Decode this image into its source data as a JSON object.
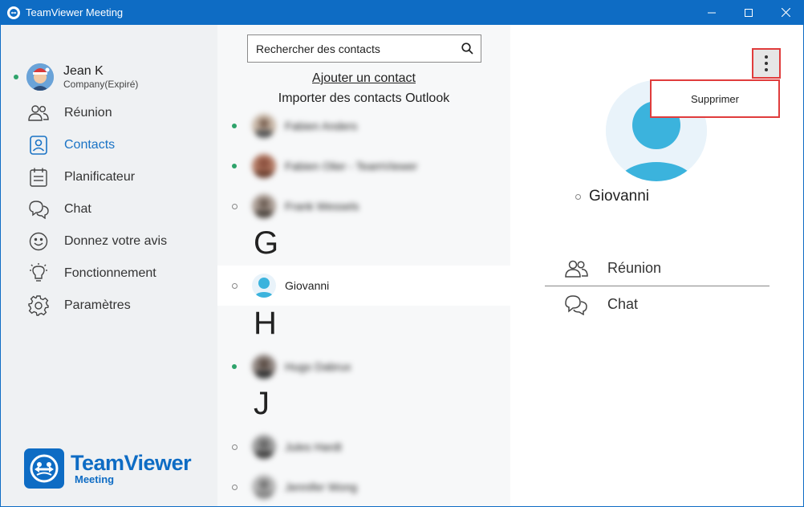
{
  "window": {
    "title": "TeamViewer Meeting"
  },
  "user": {
    "name": "Jean K",
    "company": "Company(Expiré)"
  },
  "nav": {
    "items": [
      {
        "label": "Réunion",
        "icon": "people-icon"
      },
      {
        "label": "Contacts",
        "icon": "contact-card-icon",
        "active": true
      },
      {
        "label": "Planificateur",
        "icon": "calendar-icon"
      },
      {
        "label": "Chat",
        "icon": "chat-bubbles-icon"
      },
      {
        "label": "Donnez votre avis",
        "icon": "smiley-icon"
      },
      {
        "label": "Fonctionnement",
        "icon": "lightbulb-icon"
      },
      {
        "label": "Paramètres",
        "icon": "gear-icon"
      }
    ]
  },
  "brand": {
    "name": "TeamViewer",
    "sub": "Meeting"
  },
  "contacts": {
    "search_placeholder": "Rechercher des contacts",
    "add_contact": "Ajouter un contact",
    "import_outlook": "Importer des contacts Outlook",
    "list": [
      {
        "name": "Fabien Anders",
        "status": "online",
        "blurred": true
      },
      {
        "name": "Fabien Olier - TeamViewer",
        "status": "online",
        "blurred": true
      },
      {
        "name": "Frank Wessels",
        "status": "offline",
        "blurred": true
      },
      {
        "letter": "G"
      },
      {
        "name": "Giovanni",
        "status": "offline",
        "selected": true
      },
      {
        "letter": "H"
      },
      {
        "name": "Hugo Dabrux",
        "status": "online",
        "blurred": true
      },
      {
        "letter": "J"
      },
      {
        "name": "Jules Hardt",
        "status": "offline",
        "blurred": true
      },
      {
        "name": "Jennifer Wong",
        "status": "offline",
        "blurred": true
      }
    ]
  },
  "detail": {
    "name": "Giovanni",
    "status": "offline",
    "menu_item": "Supprimer",
    "actions": [
      {
        "label": "Réunion",
        "icon": "people-icon"
      },
      {
        "label": "Chat",
        "icon": "chat-bubbles-icon"
      }
    ]
  },
  "colors": {
    "brand_blue": "#0e6cc4",
    "active_blue": "#1a73c5",
    "online_green": "#2ea36b",
    "highlight_red": "#e03c3c"
  }
}
